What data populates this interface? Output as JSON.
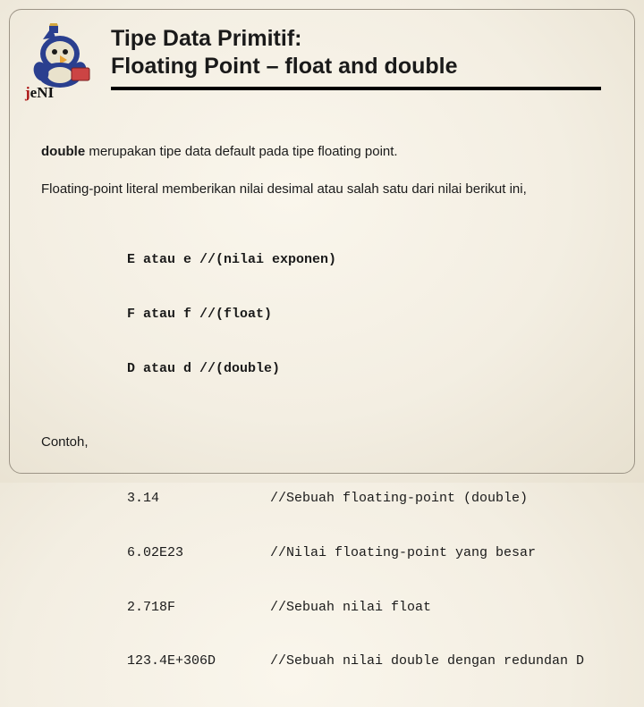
{
  "title": {
    "line1": "Tipe Data Primitif:",
    "line2": "Floating Point – float and double"
  },
  "para1": {
    "bold": "double",
    "rest": " merupakan tipe data default pada tipe floating point."
  },
  "para2": "Floating-point literal memberikan nilai desimal atau salah satu dari nilai berikut ini,",
  "suffixes": [
    {
      "text": "E atau e //(nilai exponen)"
    },
    {
      "text": "F atau f //(float)"
    },
    {
      "text": "D atau d //(double)"
    }
  ],
  "contoh_label": "Contoh,",
  "examples": [
    {
      "value": "3.14",
      "comment": "//Sebuah floating-point (double)"
    },
    {
      "value": "6.02E23",
      "comment": "//Nilai floating-point yang besar"
    },
    {
      "value": "2.718F",
      "comment": "//Sebuah nilai float"
    },
    {
      "value": "123.4E+306D",
      "comment": "//Sebuah nilai double dengan redundan D"
    }
  ],
  "logo_alt": "jeni-logo"
}
